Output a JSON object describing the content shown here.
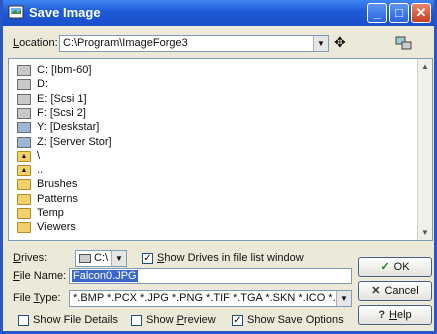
{
  "window": {
    "title": "Save Image",
    "min_glyph": "_",
    "max_glyph": "□",
    "close_glyph": "✕"
  },
  "location": {
    "label": "Location:",
    "label_access": "L",
    "label_rest": "ocation:",
    "value": "C:\\Program\\ImageForge3"
  },
  "file_list": {
    "items": [
      {
        "label": "C: [Ibm-60]",
        "icon": "drive-icon"
      },
      {
        "label": "D:",
        "icon": "drive-icon"
      },
      {
        "label": "E: [Scsi 1]",
        "icon": "drive-icon"
      },
      {
        "label": "F: [Scsi 2]",
        "icon": "drive-icon"
      },
      {
        "label": "Y: [Deskstar]",
        "icon": "network-drive-icon"
      },
      {
        "label": "Z: [Server Stor]",
        "icon": "network-drive-icon"
      },
      {
        "label": "\\",
        "icon": "parent-folder-icon"
      },
      {
        "label": "..",
        "icon": "parent-folder-icon"
      },
      {
        "label": "Brushes",
        "icon": "folder-icon"
      },
      {
        "label": "Patterns",
        "icon": "folder-icon"
      },
      {
        "label": "Temp",
        "icon": "folder-icon"
      },
      {
        "label": "Viewers",
        "icon": "folder-icon"
      }
    ]
  },
  "drives": {
    "label_access": "D",
    "label_rest": "rives:",
    "value": "C:\\",
    "show_drives_access": "S",
    "show_drives_rest": "how Drives in file list window",
    "show_drives_checked": true
  },
  "file_name": {
    "label_access": "F",
    "label_rest": "ile Name:",
    "value": "Falcon0.JPG"
  },
  "file_type": {
    "label_pre": "File ",
    "label_access": "T",
    "label_rest": "ype:",
    "value": "*.BMP *.PCX *.JPG *.PNG *.TIF *.TGA *.SKN *.ICO *.PBM *.P"
  },
  "options": {
    "file_details": {
      "label": "Show File Details",
      "checked": false
    },
    "preview_pre": "Show ",
    "preview_access": "P",
    "preview_rest": "review",
    "preview_checked": false,
    "save_options": {
      "label": "Show Save Options",
      "checked": true
    }
  },
  "buttons": {
    "ok": "OK",
    "ok_glyph": "✓",
    "cancel": "Cancel",
    "cancel_glyph": "✕",
    "help_access": "H",
    "help_rest": "elp",
    "help_glyph": "?"
  },
  "glyphs": {
    "check": "✓",
    "down": "▼",
    "up": "▲",
    "add": "✥",
    "parent": "▲"
  }
}
